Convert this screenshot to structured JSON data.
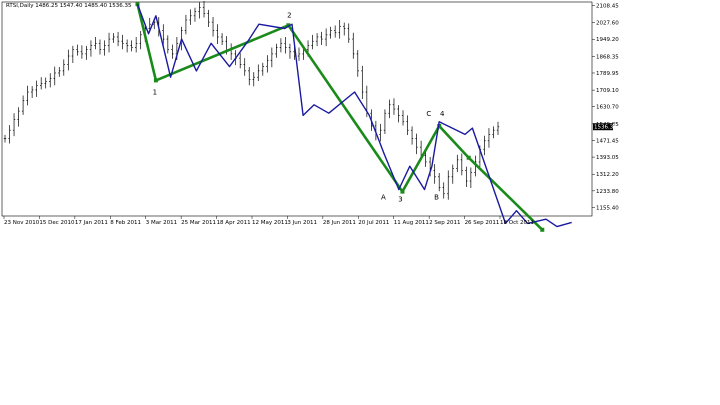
{
  "chart_data": {
    "type": "candlestick",
    "title": "RTSI,Daily  1486.25 1547.40 1485.40 1536.35",
    "y_ticks": [
      "2108.45",
      "2027.60",
      "1949.20",
      "1868.35",
      "1789.95",
      "1709.10",
      "1630.70",
      "1549.85",
      "1471.45",
      "1393.05",
      "1312.20",
      "1233.80",
      "1155.40"
    ],
    "y_tick_values": [
      2108.45,
      2027.6,
      1949.2,
      1868.35,
      1789.95,
      1709.1,
      1630.7,
      1549.85,
      1471.45,
      1393.05,
      1312.2,
      1233.8,
      1155.4
    ],
    "ylim": [
      1115,
      2125
    ],
    "x_ticks": [
      "23 Nov 2010",
      "15 Dec 2010",
      "17 Jan 2011",
      "8 Feb 2011",
      "3 Mar 2011",
      "25 Mar 2011",
      "18 Apr 2011",
      "12 May 2011",
      "3 Jun 2011",
      "28 Jun 2011",
      "20 Jul 2011",
      "11 Aug 2011",
      "2 Sep 2011",
      "26 Sep 2011",
      "18 Oct 2011"
    ],
    "current_price_label": "1536.35",
    "current_price": 1536.35,
    "close_series_approx": [
      1480,
      1520,
      1570,
      1610,
      1660,
      1700,
      1710,
      1730,
      1740,
      1750,
      1765,
      1790,
      1800,
      1830,
      1870,
      1900,
      1890,
      1880,
      1900,
      1920,
      1930,
      1900,
      1920,
      1950,
      1960,
      1940,
      1930,
      1920,
      1910,
      1930,
      1970,
      2000,
      2020,
      2030,
      1990,
      1950,
      1900,
      1880,
      1930,
      1990,
      2040,
      2060,
      2080,
      2100,
      2070,
      2030,
      1990,
      1960,
      1940,
      1900,
      1880,
      1860,
      1830,
      1800,
      1760,
      1770,
      1800,
      1820,
      1850,
      1880,
      1910,
      1930,
      1910,
      1890,
      1870,
      1880,
      1900,
      1920,
      1940,
      1960,
      1950,
      1970,
      1990,
      1980,
      2010,
      2000,
      1950,
      1880,
      1800,
      1700,
      1600,
      1540,
      1500,
      1520,
      1600,
      1640,
      1620,
      1590,
      1560,
      1520,
      1480,
      1440,
      1400,
      1370,
      1330,
      1300,
      1250,
      1220,
      1300,
      1340,
      1380,
      1330,
      1280,
      1320,
      1370,
      1430,
      1470,
      1500,
      1520,
      1536
    ],
    "green_wave_points": [
      [
        46.4,
        2115
      ],
      [
        46.9,
        1755
      ],
      [
        50.5,
        2015
      ],
      [
        53.6,
        1230
      ],
      [
        54.6,
        1540
      ],
      [
        55.4,
        1390
      ],
      [
        57.4,
        1050
      ]
    ],
    "blue_wave_points": [
      [
        46.4,
        2115
      ],
      [
        46.7,
        1975
      ],
      [
        46.9,
        2060
      ],
      [
        47.3,
        1770
      ],
      [
        47.6,
        1950
      ],
      [
        48.0,
        1800
      ],
      [
        48.4,
        1930
      ],
      [
        48.9,
        1820
      ],
      [
        49.4,
        1940
      ],
      [
        49.7,
        2020
      ],
      [
        50.4,
        2000
      ],
      [
        50.6,
        2020
      ],
      [
        50.9,
        1590
      ],
      [
        51.2,
        1640
      ],
      [
        51.6,
        1600
      ],
      [
        52.3,
        1700
      ],
      [
        52.7,
        1590
      ],
      [
        53.1,
        1410
      ],
      [
        53.5,
        1240
      ],
      [
        53.8,
        1350
      ],
      [
        54.2,
        1240
      ],
      [
        54.4,
        1350
      ],
      [
        54.6,
        1560
      ],
      [
        55.3,
        1500
      ],
      [
        55.5,
        1530
      ],
      [
        56.4,
        1080
      ],
      [
        56.7,
        1140
      ],
      [
        57.0,
        1080
      ],
      [
        57.5,
        1100
      ],
      [
        57.8,
        1065
      ],
      [
        58.2,
        1085
      ]
    ],
    "wave_labels": [
      {
        "text": "1",
        "x": 46.9,
        "y": 1755
      },
      {
        "text": "2",
        "x": 50.5,
        "y": 2015
      },
      {
        "text": "3",
        "x": 53.6,
        "y": 1230
      },
      {
        "text": "4",
        "x": 54.6,
        "y": 1540
      },
      {
        "text": "A",
        "x": 53.3,
        "y": 1230
      },
      {
        "text": "B",
        "x": 54.2,
        "y": 1240
      },
      {
        "text": "C",
        "x": 54.4,
        "y": 1540
      }
    ],
    "colors": {
      "green": "#1a8a1a",
      "blue": "#1a1aa0",
      "candle": "#000000",
      "axis": "#000000",
      "price_tag_bg": "#000000",
      "price_tag_text": "#ffffff"
    }
  }
}
